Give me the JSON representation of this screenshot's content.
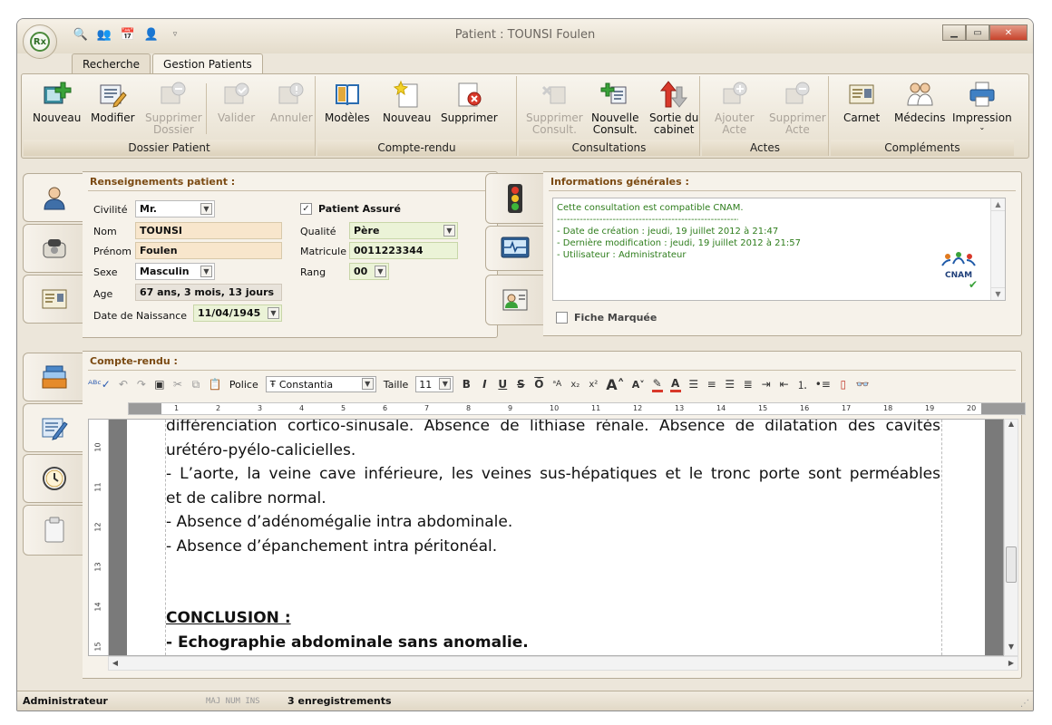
{
  "window": {
    "title": "Patient : TOUNSI  Foulen",
    "orb_label": "Rx"
  },
  "tabs": [
    {
      "label": "Recherche"
    },
    {
      "label": "Gestion Patients"
    }
  ],
  "ribbon": {
    "groups": [
      {
        "label": "Dossier Patient",
        "buttons": [
          {
            "label": "Nouveau",
            "icon": "user-add-icon"
          },
          {
            "label": "Modifier",
            "icon": "edit-form-icon"
          },
          {
            "label": "Supprimer\nDossier",
            "icon": "delete-folder-icon"
          },
          {
            "label": "Valider",
            "icon": "validate-icon"
          },
          {
            "label": "Annuler",
            "icon": "cancel-icon"
          }
        ]
      },
      {
        "label": "Compte-rendu",
        "buttons": [
          {
            "label": "Modèles",
            "icon": "book-icon"
          },
          {
            "label": "Nouveau",
            "icon": "new-document-icon"
          },
          {
            "label": "Supprimer",
            "icon": "delete-document-icon"
          }
        ]
      },
      {
        "label": "Consultations",
        "buttons": [
          {
            "label": "Supprimer\nConsult.",
            "icon": "delete-consult-icon"
          },
          {
            "label": "Nouvelle\nConsult.",
            "icon": "new-consult-icon"
          },
          {
            "label": "Sortie du\ncabinet",
            "icon": "exit-arrows-icon"
          }
        ]
      },
      {
        "label": "Actes",
        "buttons": [
          {
            "label": "Ajouter\nActe",
            "icon": "add-act-icon"
          },
          {
            "label": "Supprimer\nActe",
            "icon": "delete-act-icon"
          }
        ]
      },
      {
        "label": "Compléments",
        "buttons": [
          {
            "label": "Carnet",
            "icon": "id-card-icon"
          },
          {
            "label": "Médecins",
            "icon": "doctors-icon"
          },
          {
            "label": "Impression",
            "icon": "printer-icon"
          }
        ]
      }
    ]
  },
  "patient": {
    "section_title": "Renseignements patient :",
    "civilite_label": "Civilité",
    "civilite": "Mr.",
    "nom_label": "Nom",
    "nom": "TOUNSI",
    "prenom_label": "Prénom",
    "prenom": "Foulen",
    "sexe_label": "Sexe",
    "sexe": "Masculin",
    "age_label": "Age",
    "age": "67 ans,  3 mois, 13 jours",
    "dob_label": "Date de Naissance",
    "dob": "11/04/1945",
    "assure_label": "Patient Assuré",
    "assure": true,
    "qualite_label": "Qualité",
    "qualite": "Père",
    "matricule_label": "Matricule",
    "matricule": "0011223344",
    "rang_label": "Rang",
    "rang": "00"
  },
  "info": {
    "section_title": "Informations générales :",
    "line1": "Cette consultation est compatible CNAM.",
    "divider": "---------------------------------------------------------------------------",
    "line2": "- Date de création : jeudi, 19 juillet 2012 à 21:47",
    "line3": "- Dernière modification : jeudi, 19 juillet 2012 à 21:57",
    "line4": "- Utilisateur : Administrateur",
    "cnam_logo": "CNAM",
    "fiche_marquee_label": "Fiche Marquée"
  },
  "compte_rendu": {
    "section_title": "Compte-rendu :",
    "police_label": "Police",
    "font_value": "Constantia",
    "taille_label": "Taille",
    "size_value": "11",
    "ruler_marks": [
      "1",
      "2",
      "3",
      "4",
      "5",
      "6",
      "7",
      "8",
      "9",
      "10",
      "11",
      "12",
      "13",
      "14",
      "15",
      "16",
      "17",
      "18",
      "19",
      "20"
    ],
    "vruler_marks": [
      "10",
      "11",
      "12",
      "13",
      "14",
      "15"
    ],
    "lines": [
      "différenciation cortico-sinusale. Absence de lithiase rénale. Absence de dilatation des cavités",
      "urétéro-pyélo-calicielles.",
      "- L’aorte, la veine cave inférieure, les veines sus-hépatiques et le tronc porte sont perméables",
      "et de calibre normal.",
      "- Absence d’adénomégalie intra abdominale.",
      "- Absence d’épanchement intra péritonéal."
    ],
    "conclusion_title": "CONCLUSION :",
    "conclusion_text": "- Echographie abdominale sans anomalie."
  },
  "status": {
    "user": "Administrateur",
    "keys": "MAJ  NUM  INS",
    "records": "3 enregistrements"
  }
}
